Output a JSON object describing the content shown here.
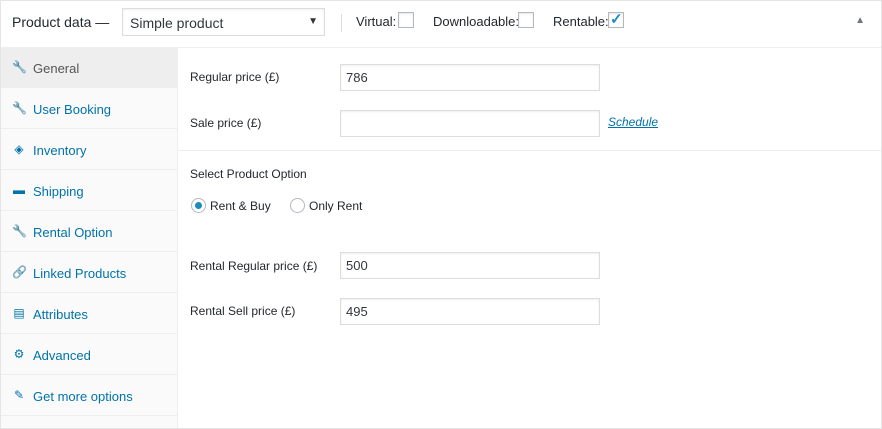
{
  "header": {
    "title": "Product data —",
    "product_type": "Simple product",
    "virtual_label": "Virtual:",
    "downloadable_label": "Downloadable:",
    "rentable_label": "Rentable:",
    "virtual_checked": false,
    "downloadable_checked": false,
    "rentable_checked": true
  },
  "tabs": [
    {
      "label": "General",
      "icon": "wrench-icon",
      "active": true
    },
    {
      "label": "User Booking",
      "icon": "wrench-icon",
      "active": false
    },
    {
      "label": "Inventory",
      "icon": "tag-icon",
      "active": false
    },
    {
      "label": "Shipping",
      "icon": "truck-icon",
      "active": false
    },
    {
      "label": "Rental Option",
      "icon": "wrench-icon",
      "active": false
    },
    {
      "label": "Linked Products",
      "icon": "link-icon",
      "active": false
    },
    {
      "label": "Attributes",
      "icon": "list-icon",
      "active": false
    },
    {
      "label": "Advanced",
      "icon": "gear-icon",
      "active": false
    },
    {
      "label": "Get more options",
      "icon": "plugin-icon",
      "active": false
    }
  ],
  "general": {
    "regular_price_label": "Regular price (£)",
    "regular_price_value": "786",
    "sale_price_label": "Sale price (£)",
    "sale_price_value": "",
    "schedule_link": "Schedule"
  },
  "rental": {
    "section_title": "Select Product Option",
    "option_rent_buy": "Rent & Buy",
    "option_only_rent": "Only Rent",
    "selected": "Rent & Buy",
    "rental_regular_label": "Rental Regular price (£)",
    "rental_regular_value": "500",
    "rental_sell_label": "Rental Sell price (£)",
    "rental_sell_value": "495"
  },
  "colors": {
    "accent": "#0073aa",
    "check": "#1e8cbe"
  }
}
